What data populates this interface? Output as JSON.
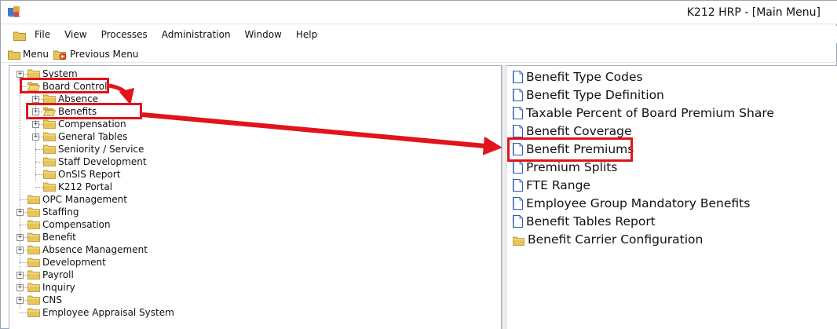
{
  "window": {
    "title": "K212 HRP - [Main Menu]"
  },
  "menubar": {
    "items": [
      "File",
      "View",
      "Processes",
      "Administration",
      "Window",
      "Help"
    ]
  },
  "toolbar": {
    "menu_label": "Menu",
    "previous_menu_label": "Previous Menu"
  },
  "tree": {
    "items": [
      {
        "label": "System",
        "expandable": true,
        "level": 0
      },
      {
        "label": "Board Control",
        "expandable": false,
        "level": 0,
        "open": true
      },
      {
        "label": "Absence",
        "expandable": true,
        "level": 1
      },
      {
        "label": "Benefits",
        "expandable": true,
        "level": 1,
        "open": true
      },
      {
        "label": "Compensation",
        "expandable": true,
        "level": 1
      },
      {
        "label": "General Tables",
        "expandable": true,
        "level": 1
      },
      {
        "label": "Seniority / Service",
        "expandable": false,
        "level": 1
      },
      {
        "label": "Staff Development",
        "expandable": false,
        "level": 1
      },
      {
        "label": "OnSIS Report",
        "expandable": false,
        "level": 1
      },
      {
        "label": "K212 Portal",
        "expandable": false,
        "level": 1
      },
      {
        "label": "OPC Management",
        "expandable": false,
        "level": 0
      },
      {
        "label": "Staffing",
        "expandable": true,
        "level": 0
      },
      {
        "label": "Compensation",
        "expandable": false,
        "level": 0
      },
      {
        "label": "Benefit",
        "expandable": true,
        "level": 0
      },
      {
        "label": "Absence Management",
        "expandable": true,
        "level": 0
      },
      {
        "label": "Development",
        "expandable": false,
        "level": 0
      },
      {
        "label": "Payroll",
        "expandable": true,
        "level": 0
      },
      {
        "label": "Inquiry",
        "expandable": true,
        "level": 0
      },
      {
        "label": "CNS",
        "expandable": true,
        "level": 0
      },
      {
        "label": "Employee Appraisal System",
        "expandable": false,
        "level": 0
      }
    ]
  },
  "list": {
    "items": [
      {
        "label": "Benefit Type Codes",
        "icon": "document-icon"
      },
      {
        "label": "Benefit Type Definition",
        "icon": "document-icon"
      },
      {
        "label": "Taxable Percent of Board Premium Share",
        "icon": "document-icon"
      },
      {
        "label": "Benefit Coverage",
        "icon": "document-icon"
      },
      {
        "label": "Benefit Premiums",
        "icon": "document-icon"
      },
      {
        "label": "Premium Splits",
        "icon": "document-icon"
      },
      {
        "label": "FTE Range",
        "icon": "document-icon"
      },
      {
        "label": "Employee Group Mandatory Benefits",
        "icon": "document-icon"
      },
      {
        "label": "Benefit Tables Report",
        "icon": "document-icon"
      },
      {
        "label": "Benefit Carrier Configuration",
        "icon": "folder-icon"
      }
    ]
  },
  "colors": {
    "annotation": "#e1141b",
    "folder": "#e8c55a",
    "folder_dark": "#b8902a",
    "doc_blue": "#2f5fb3"
  }
}
